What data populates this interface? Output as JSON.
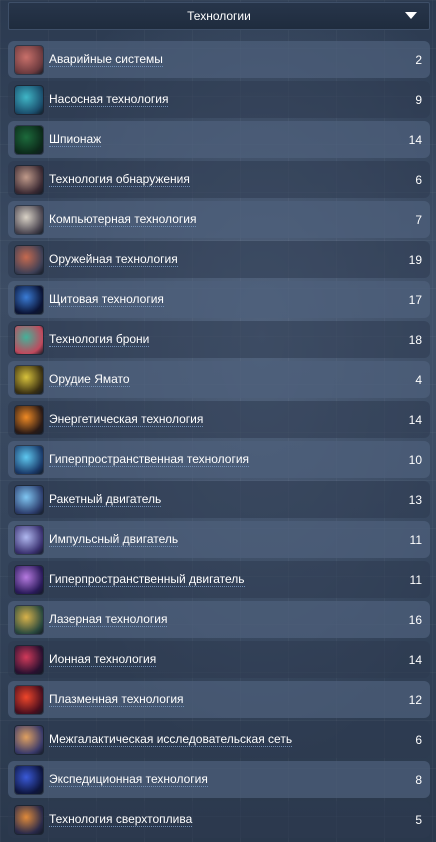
{
  "header": {
    "title": "Технологии"
  },
  "technologies": [
    {
      "name": "Аварийные системы",
      "level": "2",
      "icon": "emergency-systems-icon",
      "colors": [
        "#c9706a",
        "#6b3a3e"
      ]
    },
    {
      "name": "Насосная технология",
      "level": "9",
      "icon": "pump-technology-icon",
      "colors": [
        "#3fb6c6",
        "#1b4f6e"
      ]
    },
    {
      "name": "Шпионаж",
      "level": "14",
      "icon": "espionage-icon",
      "colors": [
        "#1d6b3c",
        "#0c2a1a"
      ]
    },
    {
      "name": "Технология обнаружения",
      "level": "6",
      "icon": "detection-technology-icon",
      "colors": [
        "#c09a8a",
        "#3b2a33"
      ]
    },
    {
      "name": "Компьютерная технология",
      "level": "7",
      "icon": "computer-technology-icon",
      "colors": [
        "#d9d2c6",
        "#4a4550"
      ]
    },
    {
      "name": "Оружейная технология",
      "level": "19",
      "icon": "weapons-technology-icon",
      "colors": [
        "#c66a4f",
        "#3d3f55"
      ]
    },
    {
      "name": "Щитовая технология",
      "level": "17",
      "icon": "shield-technology-icon",
      "colors": [
        "#3a7cd6",
        "#0b1436"
      ]
    },
    {
      "name": "Технология брони",
      "level": "18",
      "icon": "armor-technology-icon",
      "colors": [
        "#43b29a",
        "#c0495d"
      ]
    },
    {
      "name": "Орудие Ямато",
      "level": "4",
      "icon": "yamato-cannon-icon",
      "colors": [
        "#d8c23b",
        "#3a3012"
      ]
    },
    {
      "name": "Энергетическая технология",
      "level": "14",
      "icon": "energy-technology-icon",
      "colors": [
        "#f08a24",
        "#2a1a16"
      ]
    },
    {
      "name": "Гиперпространственная технология",
      "level": "10",
      "icon": "hyperspace-technology-icon",
      "colors": [
        "#5ec8f0",
        "#1a3a6a"
      ]
    },
    {
      "name": "Ракетный двигатель",
      "level": "13",
      "icon": "rocket-engine-icon",
      "colors": [
        "#7fc6f2",
        "#2d3e6e"
      ]
    },
    {
      "name": "Импульсный двигатель",
      "level": "11",
      "icon": "impulse-engine-icon",
      "colors": [
        "#b0b8f0",
        "#3a3170"
      ]
    },
    {
      "name": "Гиперпространственный двигатель",
      "level": "11",
      "icon": "hyperspace-engine-icon",
      "colors": [
        "#b67ae0",
        "#2a1a5a"
      ]
    },
    {
      "name": "Лазерная технология",
      "level": "16",
      "icon": "laser-technology-icon",
      "colors": [
        "#d8b24a",
        "#2b4a3e"
      ]
    },
    {
      "name": "Ионная технология",
      "level": "14",
      "icon": "ion-technology-icon",
      "colors": [
        "#d23a5a",
        "#2a1030"
      ]
    },
    {
      "name": "Плазменная технология",
      "level": "12",
      "icon": "plasma-technology-icon",
      "colors": [
        "#f0462a",
        "#4a0e1e"
      ]
    },
    {
      "name": "Межгалактическая исследовательская сеть",
      "level": "6",
      "icon": "intergalactic-research-network-icon",
      "colors": [
        "#e0a060",
        "#3a3a6a"
      ]
    },
    {
      "name": "Экспедиционная технология",
      "level": "8",
      "icon": "expedition-technology-icon",
      "colors": [
        "#3a5ad8",
        "#0e1640"
      ]
    },
    {
      "name": "Технология сверхтоплива",
      "level": "5",
      "icon": "superfuel-technology-icon",
      "colors": [
        "#e08a3a",
        "#2a2a4a"
      ]
    }
  ]
}
